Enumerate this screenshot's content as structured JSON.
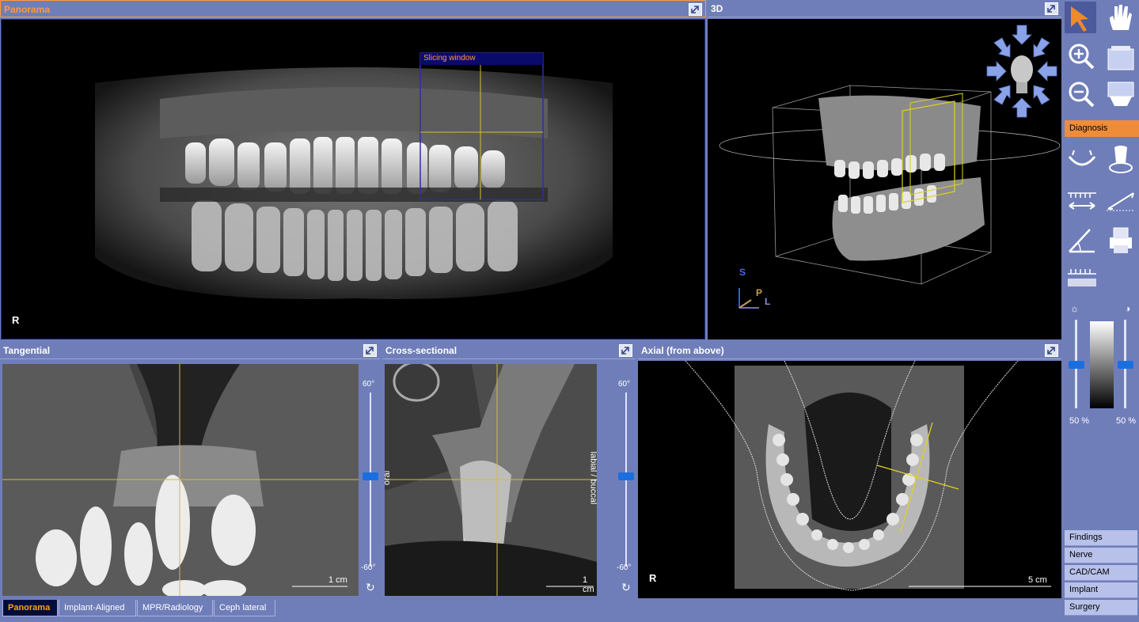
{
  "colors": {
    "frame": "#6f7eb9",
    "active_title": "#ff9a3a",
    "crosshair": "#d4c02a",
    "diagnosis_bg": "#ef8c3a"
  },
  "panels": {
    "panorama": {
      "title": "Panorama",
      "orientation": "R",
      "slicing_window": "Slicing window"
    },
    "view3d": {
      "title": "3D",
      "axis_s": "S",
      "axis_p": "P",
      "axis_l": "L"
    },
    "tangential": {
      "title": "Tangential",
      "scale": "1 cm",
      "angle_top": "60°",
      "angle_bottom": "-60°"
    },
    "cross": {
      "title": "Cross-sectional",
      "scale": "1 cm",
      "angle_top": "60°",
      "angle_bottom": "-60°",
      "label_left": "oral",
      "label_right": "labial / buccal"
    },
    "axial": {
      "title": "Axial (from above)",
      "scale": "5 cm",
      "orientation": "R"
    }
  },
  "tabs": [
    {
      "label": "Panorama",
      "selected": true
    },
    {
      "label": "Implant-Aligned"
    },
    {
      "label": "MPR/Radiology"
    },
    {
      "label": "Ceph lateral"
    }
  ],
  "sidebar": {
    "section": "Diagnosis",
    "brightness": "50 %",
    "contrast": "50 %",
    "menu": [
      "Findings",
      "Nerve",
      "CAD/CAM",
      "Implant",
      "Surgery"
    ],
    "tools": [
      "pointer-icon",
      "hand-icon",
      "zoom-in-icon",
      "layer-up-icon",
      "zoom-out-icon",
      "layer-down-icon",
      "arch-icon",
      "tooth-icon",
      "measure-icon",
      "measure-diagonal-icon",
      "angle-icon",
      "printer-icon",
      "density-ruler-icon"
    ]
  }
}
